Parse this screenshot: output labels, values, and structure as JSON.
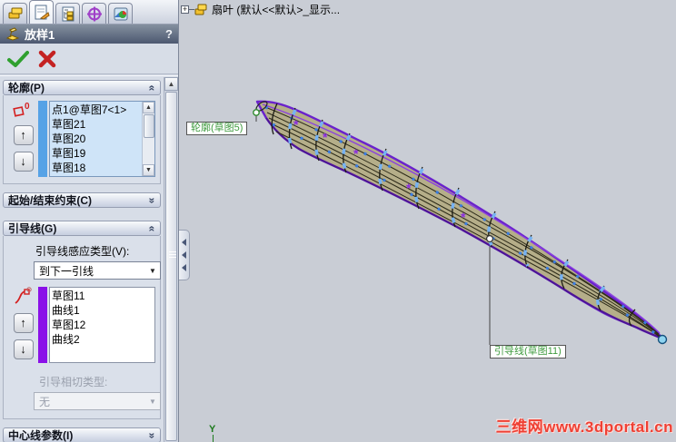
{
  "property_manager": {
    "title": "放样1",
    "help_glyph": "?",
    "ok_label": "ok-accept",
    "cancel_label": "cancel",
    "profiles": {
      "header": "轮廓(P)",
      "count_badge": "0",
      "items": [
        "点1@草图7<1>",
        "草图21",
        "草图20",
        "草图19",
        "草图18"
      ]
    },
    "start_end": {
      "header": "起始/结束约束(C)"
    },
    "guides": {
      "header": "引导线(G)",
      "influence_label": "引导线感应类型(V):",
      "influence_value": "到下一引线",
      "items": [
        "草图11",
        "曲线1",
        "草图12",
        "曲线2"
      ],
      "tangency_label": "引导相切类型:",
      "tangency_value": "无"
    },
    "centerline": {
      "header": "中心线参数(I)"
    }
  },
  "viewport": {
    "feature_tree_root": "扇叶  (默认<<默认>_显示...",
    "tree_expand_glyph": "+",
    "profile_callout": "轮廓(草图5)",
    "guide_callout": "引导线(草图11)",
    "triad_y_label": "Y",
    "watermark": "三维网www.3dportal.cn"
  },
  "glyphs": {
    "collapse_expanded": "«",
    "collapse_collapsed": "»",
    "move_up": "↑",
    "move_down": "↓",
    "dropdown": "▼",
    "scroll_up": "▲",
    "scroll_down": "▼"
  },
  "colors": {
    "profile_selection_bar": "#56a2e6",
    "guide_selection_bar": "#8a10e8",
    "loft_preview_outline": "#7a2fd8",
    "loft_preview_surface": "#b3ab82",
    "connector_ticks": "#76b2f2",
    "callout_text": "#3f9b3f",
    "watermark_red": "#ee4034"
  }
}
